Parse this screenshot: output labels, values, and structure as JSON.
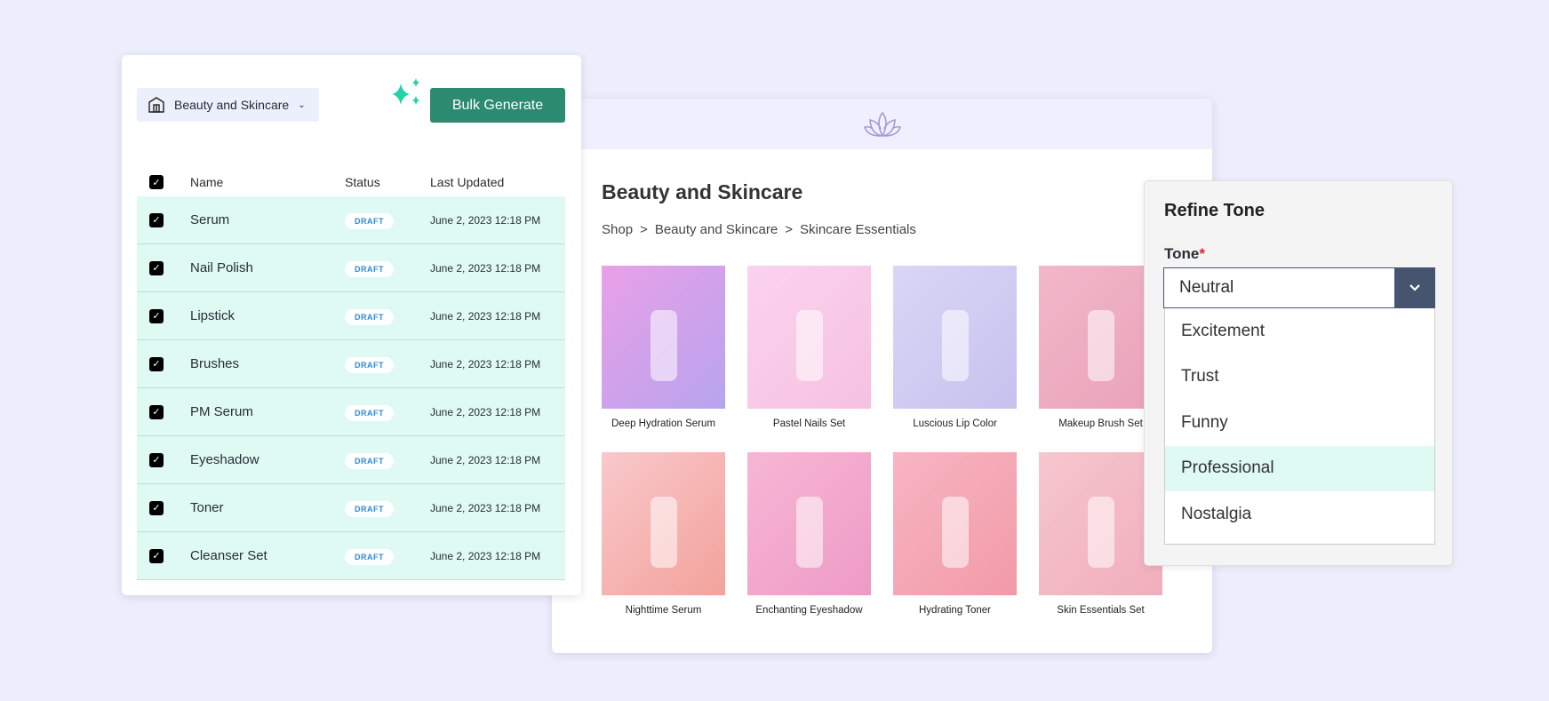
{
  "left_panel": {
    "category": "Beauty and Skincare",
    "bulk_label": "Bulk Generate",
    "headers": {
      "name": "Name",
      "status": "Status",
      "updated": "Last Updated"
    },
    "rows": [
      {
        "name": "Serum",
        "status": "DRAFT",
        "updated": "June 2, 2023  12:18 PM"
      },
      {
        "name": "Nail Polish",
        "status": "DRAFT",
        "updated": "June 2, 2023  12:18 PM"
      },
      {
        "name": "Lipstick",
        "status": "DRAFT",
        "updated": "June 2, 2023  12:18 PM"
      },
      {
        "name": "Brushes",
        "status": "DRAFT",
        "updated": "June 2, 2023  12:18 PM"
      },
      {
        "name": "PM Serum",
        "status": "DRAFT",
        "updated": "June 2, 2023  12:18 PM"
      },
      {
        "name": "Eyeshadow",
        "status": "DRAFT",
        "updated": "June 2, 2023  12:18 PM"
      },
      {
        "name": "Toner",
        "status": "DRAFT",
        "updated": "June 2, 2023  12:18 PM"
      },
      {
        "name": "Cleanser Set",
        "status": "DRAFT",
        "updated": "June 2, 2023  12:18 PM"
      }
    ]
  },
  "shop": {
    "title": "Beauty and Skincare",
    "breadcrumb": [
      "Shop",
      ">",
      "Beauty and Skincare",
      ">",
      "Skincare Essentials"
    ],
    "products": [
      {
        "name": "Deep Hydration Serum",
        "colors": [
          "#e9a0e8",
          "#b7a4ee"
        ]
      },
      {
        "name": "Pastel Nails Set",
        "colors": [
          "#fbd3ee",
          "#f6c1e2"
        ]
      },
      {
        "name": "Luscious Lip Color",
        "colors": [
          "#d9d6f6",
          "#c6c2ee"
        ]
      },
      {
        "name": "Makeup Brush Set",
        "colors": [
          "#f2b7c9",
          "#e9a2b9"
        ]
      },
      {
        "name": "Nighttime Serum",
        "colors": [
          "#f9c8cb",
          "#f3a29b"
        ]
      },
      {
        "name": "Enchanting Eyeshadow",
        "colors": [
          "#f7b6d5",
          "#ee9bc5"
        ]
      },
      {
        "name": "Hydrating Toner",
        "colors": [
          "#f8b5c2",
          "#f29aa8"
        ]
      },
      {
        "name": "Skin Essentials Set",
        "colors": [
          "#f6c6cf",
          "#f0aebb"
        ]
      }
    ]
  },
  "tone_panel": {
    "title": "Refine Tone",
    "label": "Tone",
    "required": "*",
    "selected": "Neutral",
    "options": [
      "Excitement",
      "Trust",
      "Funny",
      "Professional",
      "Nostalgia"
    ],
    "highlighted": "Professional"
  },
  "colors": {
    "accent": "#2b8a70",
    "highlight": "#defaf3",
    "select": "#465470"
  }
}
